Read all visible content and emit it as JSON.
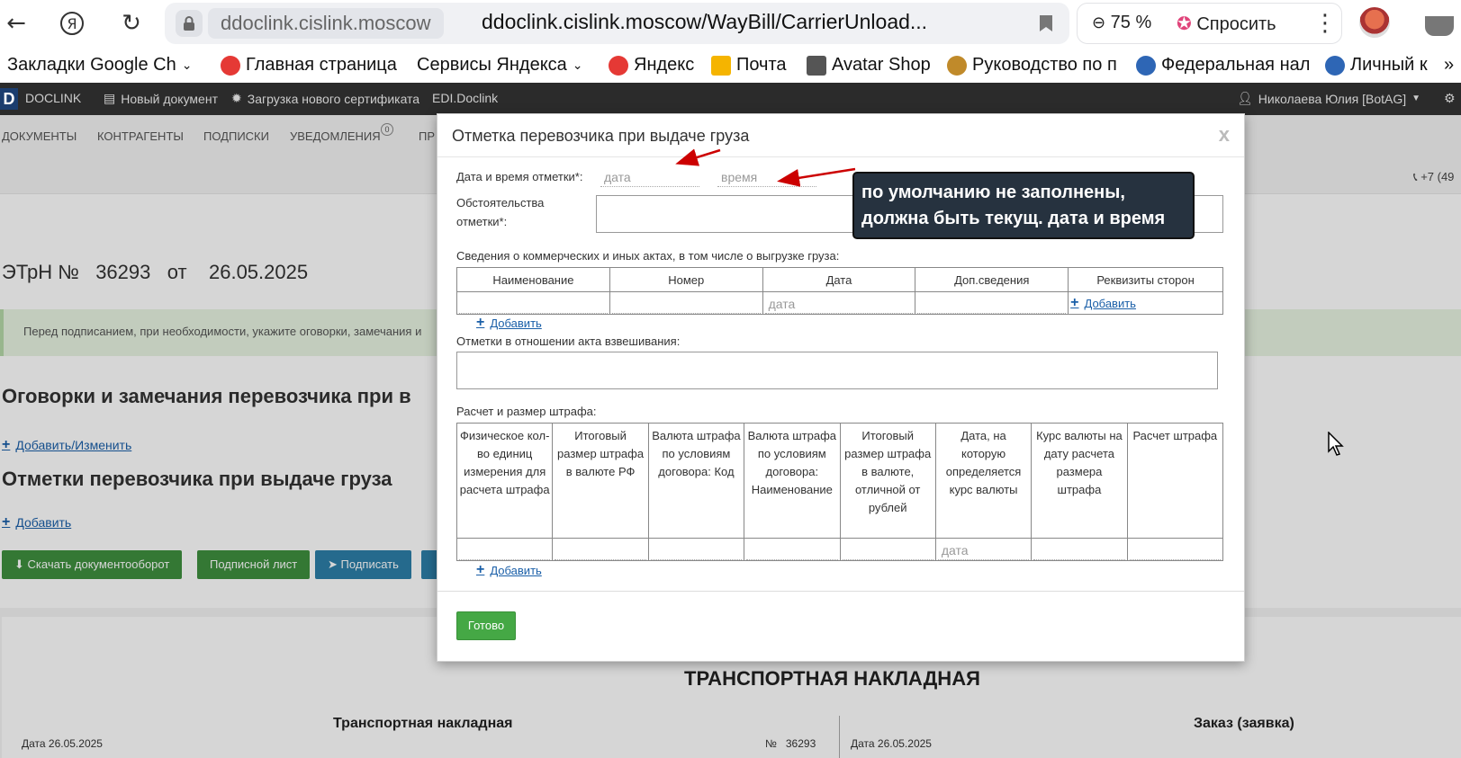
{
  "browser": {
    "host": "ddoclink.cislink.moscow",
    "url": "ddoclink.cislink.moscow/WayBill/CarrierUnload...",
    "zoom": "75 %",
    "ask_label": "Спросить"
  },
  "bookmarks": [
    {
      "label": "Закладки Google Ch",
      "color": "#f2f2f2"
    },
    {
      "label": "Главная страница",
      "color": "#e53935"
    },
    {
      "label": "Сервисы Яндекса",
      "color": "#ffffff"
    },
    {
      "label": "Яндекс",
      "color": "#e53935"
    },
    {
      "label": "Почта",
      "color": "#f5b400"
    },
    {
      "label": "Avatar Shop",
      "color": "#555555"
    },
    {
      "label": "Руководство по п",
      "color": "#c08a2a"
    },
    {
      "label": "Федеральная нал",
      "color": "#2e66b5"
    },
    {
      "label": "Личный к",
      "color": "#2e66b5"
    }
  ],
  "app_header": {
    "logo": "DOCLINK",
    "new_doc": "Новый документ",
    "upload_cert": "Загрузка нового сертификата",
    "edi": "EDI.Doclink",
    "user": "Николаева Юлия [BotAG]"
  },
  "menu": {
    "documents": "ДОКУМЕНТЫ",
    "contractors": "КОНТРАГЕНТЫ",
    "subscriptions": "ПОДПИСКИ",
    "notifications": "УВЕДОМЛЕНИЯ",
    "notifications_count": "0",
    "more": "ПР"
  },
  "page": {
    "phone": "+7 (49",
    "doc_title": "ЭТрН №   36293   от    26.05.2025",
    "info": "Перед подписанием, при необходимости, укажите оговорки, замечания и",
    "section1": "Оговорки и замечания перевозчика при в",
    "section1_link": "Добавить/Изменить",
    "section2": "Отметки перевозчика при выдаче груза",
    "section2_link": "Добавить",
    "btn_download": "Скачать документооборот",
    "btn_sign_sheet": "Подписной лист",
    "btn_sign": "Подписать",
    "sheet_title": "ТРАНСПОРТНАЯ НАКЛАДНАЯ",
    "sheet_left_sub": "Транспортная накладная",
    "sheet_right_sub": "Заказ (заявка)",
    "sheet_left_date": "Дата  26.05.2025",
    "sheet_number": "№   36293",
    "sheet_right_date": "Дата 26.05.2025"
  },
  "modal": {
    "title": "Отметка перевозчика при выдаче груза",
    "close": "x",
    "datetime_label": "Дата и время отметки*:",
    "date_placeholder": "дата",
    "time_placeholder": "время",
    "circumstances_label_1": "Обстоятельства",
    "circumstances_label_2": "отметки*:",
    "acts_label": "Сведения о коммерческих и иных актах, в том числе о выгрузке груза:",
    "acts_columns": [
      "Наименование",
      "Номер",
      "Дата",
      "Доп.сведения",
      "Реквизиты сторон"
    ],
    "acts_date_placeholder": "дата",
    "add_label": "Добавить",
    "weighing_label": "Отметки в отношении акта взвешивания:",
    "fine_label": "Расчет и размер штрафа:",
    "fine_columns": [
      "Физическое кол-во единиц измерения для расчета штрафа",
      "Итоговый размер штрафа в валюте РФ",
      "Валюта штрафа по условиям договора: Код",
      "Валюта штрафа по условиям договора: Наименование",
      "Итоговый размер штрафа в валюте, отличной от рублей",
      "Дата, на которую определяется курс валюты",
      "Курс валюты на дату расчета размера штрафа",
      "Расчет штрафа"
    ],
    "fine_date_placeholder": "дата",
    "done": "Готово"
  },
  "annotation": {
    "line1": "по умолчанию не заполнены,",
    "line2": "должна быть текущ. дата и время"
  },
  "colors": {
    "header_bg": "#2b2b2b",
    "link": "#1a5fa8",
    "green": "#45a845",
    "annotation_bg": "#26323f",
    "arrow": "#cc0000"
  }
}
